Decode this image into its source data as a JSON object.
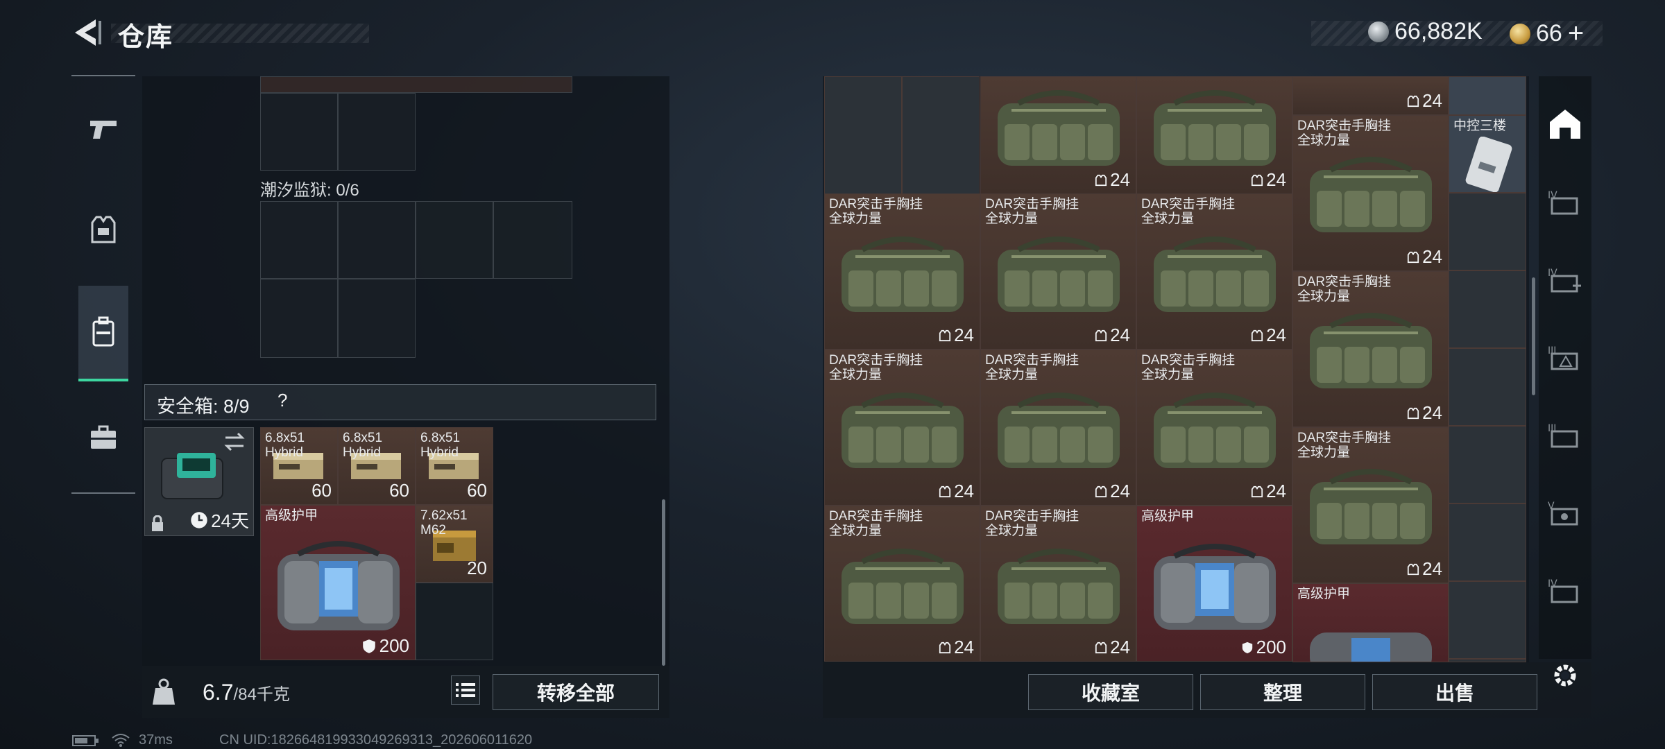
{
  "header": {
    "title": "仓库",
    "currency_silver": "66,882K",
    "currency_gold": "66",
    "currency_gold_plus": "+"
  },
  "left": {
    "section_prison": "潮汐监狱: 0/6",
    "safe_box_label": "安全箱: 8/9",
    "safe_box_help": "?",
    "safe_box_duration": "24天",
    "weight_current": "6.7",
    "weight_max": "/84千克",
    "transfer_all": "转移全部",
    "items": [
      {
        "name": "6.8x51 Hybrid",
        "count": "60"
      },
      {
        "name": "6.8x51 Hybrid",
        "count": "60"
      },
      {
        "name": "6.8x51 Hybrid",
        "count": "60"
      },
      {
        "name": "高级护甲",
        "count": "200"
      },
      {
        "name": "7.62x51 M62",
        "count": "20"
      }
    ]
  },
  "right": {
    "buttons": {
      "collection": "收藏室",
      "organize": "整理",
      "sell": "出售"
    },
    "vest_line1": "DAR突击手胸挂",
    "vest_line2": "全球力量",
    "armor_name": "高级护甲",
    "keycard_name": "中控三楼",
    "vest_count": "24",
    "armor_count": "200"
  },
  "status": {
    "ping": "37ms",
    "uid": "CN UID:182664819933049269313_202606011620"
  },
  "colors": {
    "accent": "#3dd6a0",
    "brown_cell": "#4e3b33",
    "red_cell": "#5a2a2e"
  }
}
